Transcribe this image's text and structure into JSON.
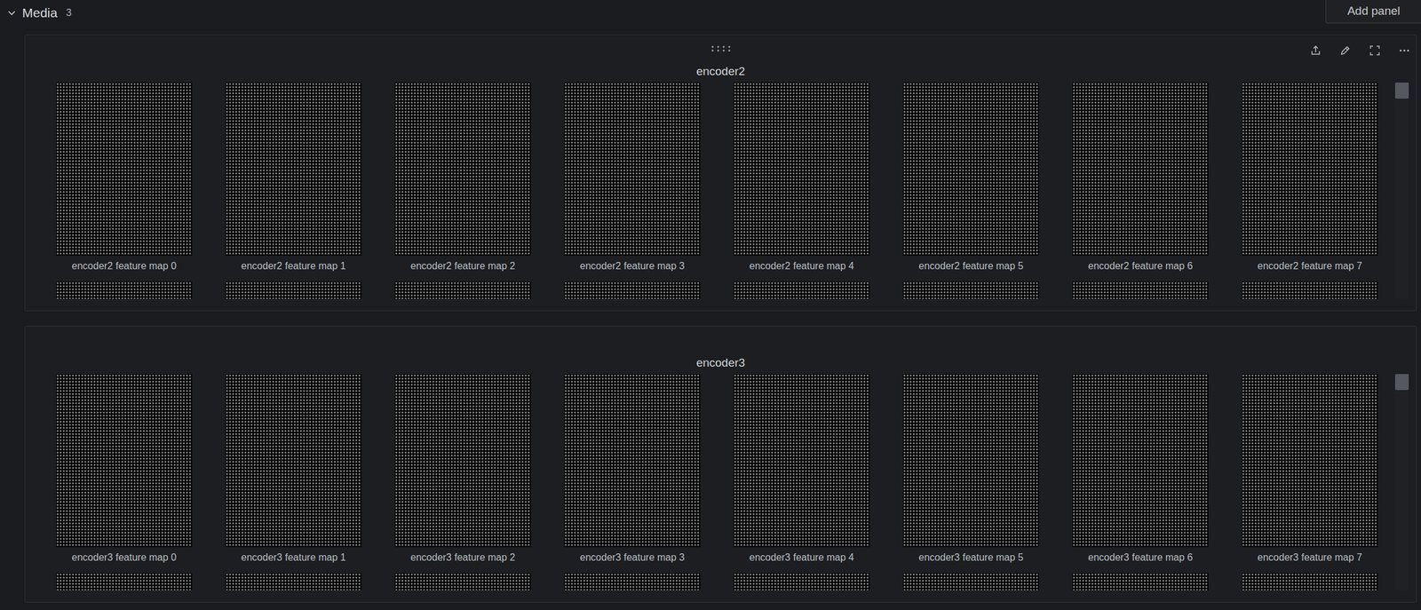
{
  "section": {
    "title": "Media",
    "count": "3",
    "expanded": true,
    "add_button": "Add panel"
  },
  "panels": [
    {
      "title": "encoder2",
      "items": [
        {
          "caption": "encoder2 feature map 0"
        },
        {
          "caption": "encoder2 feature map 1"
        },
        {
          "caption": "encoder2 feature map 2"
        },
        {
          "caption": "encoder2 feature map 3"
        },
        {
          "caption": "encoder2 feature map 4"
        },
        {
          "caption": "encoder2 feature map 5"
        },
        {
          "caption": "encoder2 feature map 6"
        },
        {
          "caption": "encoder2 feature map 7"
        }
      ],
      "next_row": [
        {},
        {},
        {},
        {},
        {},
        {},
        {},
        {}
      ],
      "scroll_level": 0.05
    },
    {
      "title": "encoder3",
      "items": [
        {
          "caption": "encoder3 feature map 0"
        },
        {
          "caption": "encoder3 feature map 1"
        },
        {
          "caption": "encoder3 feature map 2"
        },
        {
          "caption": "encoder3 feature map 3"
        },
        {
          "caption": "encoder3 feature map 4"
        },
        {
          "caption": "encoder3 feature map 5"
        },
        {
          "caption": "encoder3 feature map 6"
        },
        {
          "caption": "encoder3 feature map 7"
        }
      ],
      "next_row": [
        {},
        {},
        {},
        {},
        {},
        {},
        {},
        {}
      ],
      "scroll_level": 0.05
    }
  ]
}
